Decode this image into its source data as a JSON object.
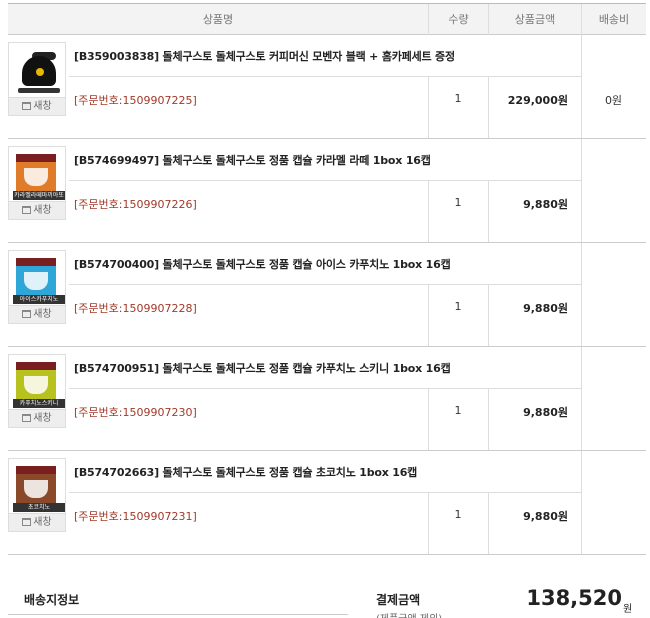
{
  "header": {
    "name": "상품명",
    "qty": "수량",
    "price": "상품금액",
    "shipping": "배송비"
  },
  "new_window_label": "새창",
  "items": [
    {
      "title": "[B359003838] 돌체구스토 돌체구스토 커피머신 모벤자 블랙 + 홈카페세트 증정",
      "order_no": "[주문번호:1509907225]",
      "qty": "1",
      "price": "229,000원",
      "shipping": "0원",
      "thumb_icon": "coffee-machine-icon",
      "thumb_label": ""
    },
    {
      "title": "[B574699497] 돌체구스토 돌체구스토 정품 캡슐 카라멜 라떼 1box 16캡",
      "order_no": "[주문번호:1509907226]",
      "qty": "1",
      "price": "9,880원",
      "shipping": "",
      "thumb_icon": "capsule-box-icon",
      "thumb_label": "카라멜라떼마끼아또",
      "thumb_color": "#e07b2a"
    },
    {
      "title": "[B574700400] 돌체구스토 돌체구스토 정품 캡슐 아이스 카푸치노 1box 16캡",
      "order_no": "[주문번호:1509907228]",
      "qty": "1",
      "price": "9,880원",
      "shipping": "",
      "thumb_icon": "capsule-box-icon",
      "thumb_label": "아이스카푸치노",
      "thumb_color": "#2fa6d8"
    },
    {
      "title": "[B574700951] 돌체구스토 돌체구스토 정품 캡슐 카푸치노 스키니 1box 16캡",
      "order_no": "[주문번호:1509907230]",
      "qty": "1",
      "price": "9,880원",
      "shipping": "",
      "thumb_icon": "capsule-box-icon",
      "thumb_label": "카푸치노스키니",
      "thumb_color": "#b8c21e"
    },
    {
      "title": "[B574702663] 돌체구스토 돌체구스토 정품 캡슐 초코치노 1box 16캡",
      "order_no": "[주문번호:1509907231]",
      "qty": "1",
      "price": "9,880원",
      "shipping": "",
      "thumb_icon": "capsule-box-icon",
      "thumb_label": "초코치노",
      "thumb_color": "#8a4a2a"
    }
  ],
  "footer": {
    "shipping_info": "배송지정보",
    "payment_label": "결제금액",
    "payment_sub": "(제품금액 제외)",
    "total": "138,520",
    "won": "원"
  }
}
